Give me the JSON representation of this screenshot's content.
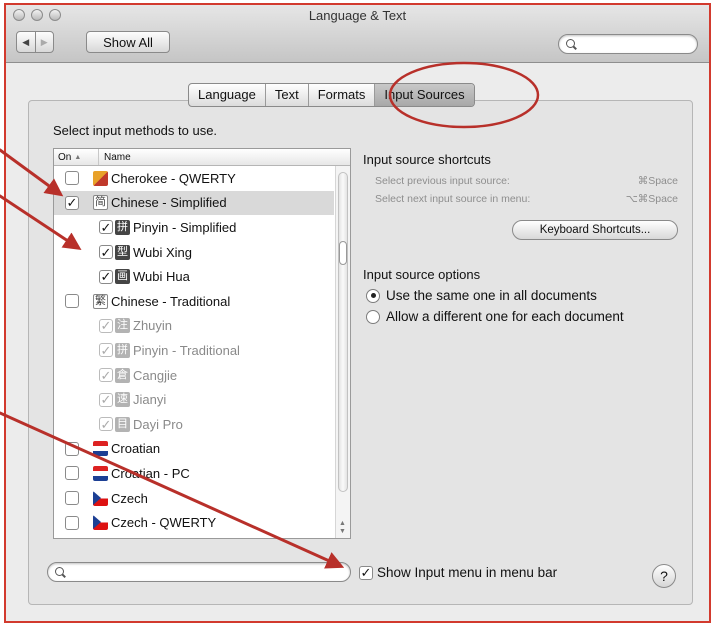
{
  "window": {
    "title": "Language & Text"
  },
  "toolbar": {
    "back_icon": "back-arrow-icon",
    "forward_icon": "forward-arrow-icon",
    "show_all_label": "Show All",
    "search_placeholder": ""
  },
  "tabs": [
    {
      "label": "Language",
      "active": false
    },
    {
      "label": "Text",
      "active": false
    },
    {
      "label": "Formats",
      "active": false
    },
    {
      "label": "Input Sources",
      "active": true
    }
  ],
  "main": {
    "prompt": "Select input methods to use.",
    "list_header": {
      "on": "On",
      "sort_indicator": "▲",
      "name": "Name"
    },
    "items": [
      {
        "label": "Cherokee - QWERTY",
        "checked": false,
        "level": "top",
        "icon": "cherokee-flag-icon",
        "selected": false,
        "muted": false
      },
      {
        "label": "Chinese - Simplified",
        "checked": true,
        "level": "top",
        "icon": "chinese-simplified-icon",
        "glyph": "简",
        "selected": true,
        "muted": false
      },
      {
        "label": "Pinyin - Simplified",
        "checked": true,
        "level": "child",
        "icon": "pinyin-icon",
        "glyph": "拼",
        "muted": false
      },
      {
        "label": "Wubi Xing",
        "checked": true,
        "level": "child",
        "icon": "wubi-xing-icon",
        "glyph": "型",
        "muted": false
      },
      {
        "label": "Wubi Hua",
        "checked": true,
        "level": "child",
        "icon": "wubi-hua-icon",
        "glyph": "画",
        "muted": false
      },
      {
        "label": "Chinese - Traditional",
        "checked": false,
        "level": "top",
        "icon": "chinese-traditional-icon",
        "glyph": "繁",
        "muted": false
      },
      {
        "label": "Zhuyin",
        "checked": true,
        "level": "child",
        "icon": "zhuyin-icon",
        "glyph": "注",
        "muted": true
      },
      {
        "label": "Pinyin - Traditional",
        "checked": true,
        "level": "child",
        "icon": "pinyin-traditional-icon",
        "glyph": "拼",
        "muted": true
      },
      {
        "label": "Cangjie",
        "checked": true,
        "level": "child",
        "icon": "cangjie-icon",
        "glyph": "倉",
        "muted": true
      },
      {
        "label": "Jianyi",
        "checked": true,
        "level": "child",
        "icon": "jianyi-icon",
        "glyph": "速",
        "muted": true
      },
      {
        "label": "Dayi Pro",
        "checked": true,
        "level": "child",
        "icon": "dayi-pro-icon",
        "glyph": "目",
        "muted": true
      },
      {
        "label": "Croatian",
        "checked": false,
        "level": "top",
        "icon": "croatian-flag-icon",
        "muted": false
      },
      {
        "label": "Croatian - PC",
        "checked": false,
        "level": "top",
        "icon": "croatian-pc-flag-icon",
        "muted": false
      },
      {
        "label": "Czech",
        "checked": false,
        "level": "top",
        "icon": "czech-flag-icon",
        "muted": false
      },
      {
        "label": "Czech - QWERTY",
        "checked": false,
        "level": "top",
        "icon": "czech-flag-icon",
        "muted": false
      }
    ]
  },
  "shortcuts": {
    "title": "Input source shortcuts",
    "prev_label": "Select previous input source:",
    "prev_key": "⌘Space",
    "next_label": "Select next input source in menu:",
    "next_key": "⌥⌘Space",
    "button_label": "Keyboard Shortcuts..."
  },
  "options": {
    "title": "Input source options",
    "radios": [
      {
        "label": "Use the same one in all documents",
        "selected": true
      },
      {
        "label": "Allow a different one for each document",
        "selected": false
      }
    ]
  },
  "bottom": {
    "search_placeholder": "",
    "show_menu_label": "Show Input menu in menu bar",
    "show_menu_checked": true,
    "help_label": "?"
  },
  "annotations": {
    "color": "#b8302a"
  }
}
